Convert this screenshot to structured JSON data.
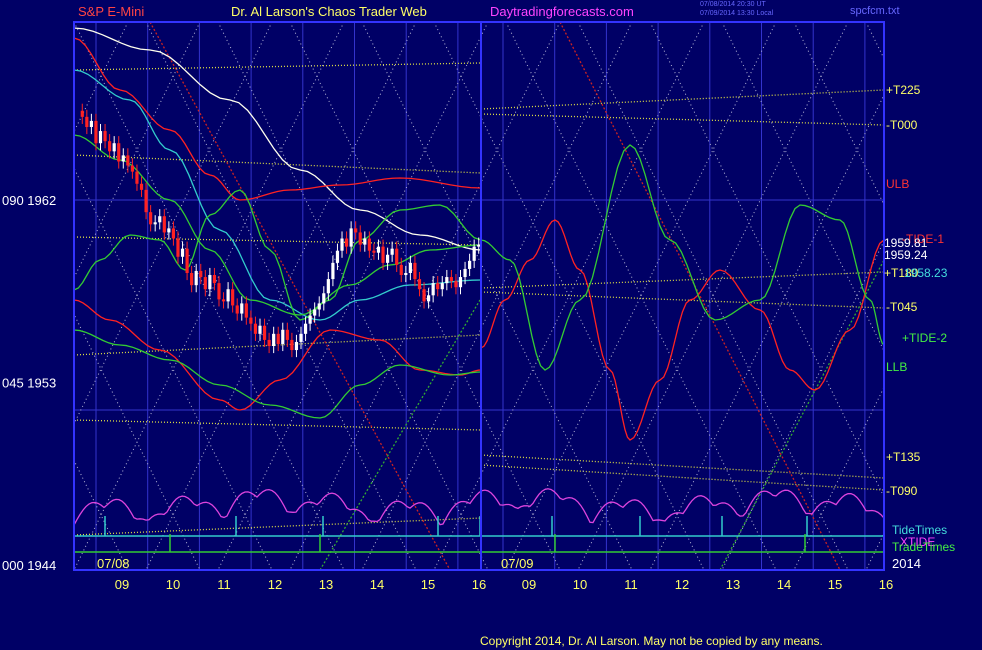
{
  "header": {
    "instrument": "S&P E-Mini",
    "site_title": "Dr. Al Larson's Chaos Trader Web",
    "site_url": "Daytradingforecasts.com",
    "timestamp_1": "07/08/2014 20:30 UT",
    "timestamp_2": "07/09/2014 13:30 Local",
    "file_name": "spcfcm.txt"
  },
  "footer": {
    "copyright": "Copyright 2014, Dr. Al Larson. May not be copied by any means."
  },
  "colors": {
    "background": "#000066",
    "plot_border": "#3333ff",
    "grid": "#3333cc",
    "red_line": "#ff2222",
    "green_line": "#33cc33",
    "cyan_line": "#33cccc",
    "white_line": "#ffffee",
    "yellow_dots": "#dddd44",
    "magenta_line": "#dd44dd",
    "label_yellow": "#ffff66",
    "label_red": "#ff3333",
    "label_green": "#44ee44",
    "label_cyan": "#44dddd",
    "label_white": "#ffffff",
    "header_red": "#ff4444",
    "header_yellow": "#ffff66",
    "header_magenta": "#ff44ff",
    "header_blue": "#6666ff"
  },
  "chart_data": {
    "type": "line",
    "title": "S&P E-Mini",
    "y_axis": {
      "ticks": [
        {
          "left": "090",
          "right": "1962",
          "value": 1962
        },
        {
          "left": "045",
          "right": "1953",
          "value": 1953
        },
        {
          "left": "000",
          "right": "1944",
          "value": 1944
        }
      ],
      "ylim": [
        1944,
        1962
      ]
    },
    "x_axis": {
      "date_labels": [
        "07/08",
        "07/09",
        "2014"
      ],
      "hour_labels_day1": [
        "09",
        "10",
        "11",
        "12",
        "13",
        "14",
        "15",
        "16"
      ],
      "hour_labels_day2": [
        "09",
        "10",
        "11",
        "12",
        "13",
        "14",
        "15",
        "16"
      ]
    },
    "price_labels": [
      "1959.81",
      "1959.24"
    ],
    "right_labels": [
      {
        "text": "+T225",
        "color": "yellow",
        "value": 1967.2
      },
      {
        "text": "-T000",
        "color": "yellow",
        "value": 1965.6
      },
      {
        "text": "ULB",
        "color": "red",
        "value": 1962.6
      },
      {
        "text": "-TIDE-1",
        "color": "red",
        "value": 1960.2
      },
      {
        "text": "+T180",
        "color": "yellow",
        "value": 1958.4
      },
      {
        "text": "1958.23",
        "color": "cyan",
        "value": 1958.3
      },
      {
        "text": "-T045",
        "color": "yellow",
        "value": 1957.1
      },
      {
        "text": "+TIDE-2",
        "color": "green",
        "value": 1956.1
      },
      {
        "text": "LLB",
        "color": "green",
        "value": 1954.0
      },
      {
        "text": "+T135",
        "color": "yellow",
        "value": 1949.6
      },
      {
        "text": "-T090",
        "color": "yellow",
        "value": 1948.2
      },
      {
        "text": "TideTimes",
        "color": "cyan"
      },
      {
        "text": "XTIDE",
        "color": "magenta"
      },
      {
        "text": "TradeTimes",
        "color": "green"
      }
    ],
    "series": [
      {
        "name": "XTIDE",
        "color": "magenta"
      },
      {
        "name": "TideTimes",
        "color": "cyan"
      },
      {
        "name": "TradeTimes",
        "color": "green"
      }
    ],
    "price_bars_close": [
      1966.1,
      1965.6,
      1965.9,
      1964.8,
      1965.4,
      1964.9,
      1964.4,
      1964.8,
      1963.9,
      1964.2,
      1963.7,
      1963.4,
      1962.8,
      1962.5,
      1961.4,
      1960.8,
      1960.9,
      1961.2,
      1960.4,
      1960.6,
      1960.1,
      1959.2,
      1959.6,
      1958.4,
      1957.8,
      1958.5,
      1958.2,
      1957.6,
      1958.3,
      1957.9,
      1957.1,
      1957.0,
      1957.6,
      1956.8,
      1956.4,
      1956.9,
      1956.2,
      1955.9,
      1955.4,
      1955.8,
      1955.1,
      1954.8,
      1955.4,
      1954.9,
      1955.6,
      1955.1,
      1954.6,
      1955.0,
      1955.4,
      1955.9,
      1956.3,
      1956.6,
      1956.9,
      1957.4,
      1958.1,
      1958.9,
      1959.5,
      1960.1,
      1959.7,
      1960.6,
      1960.4,
      1959.8,
      1960.1,
      1959.5,
      1959.4,
      1959.7,
      1958.9,
      1959.3,
      1959.6,
      1958.8,
      1958.3,
      1958.4,
      1958.9,
      1958.1,
      1957.6,
      1957.0,
      1957.3,
      1957.9,
      1957.6,
      1957.9,
      1958.2,
      1958.0,
      1957.7,
      1958.2,
      1958.6,
      1959.0,
      1959.7,
      1959.8
    ]
  }
}
